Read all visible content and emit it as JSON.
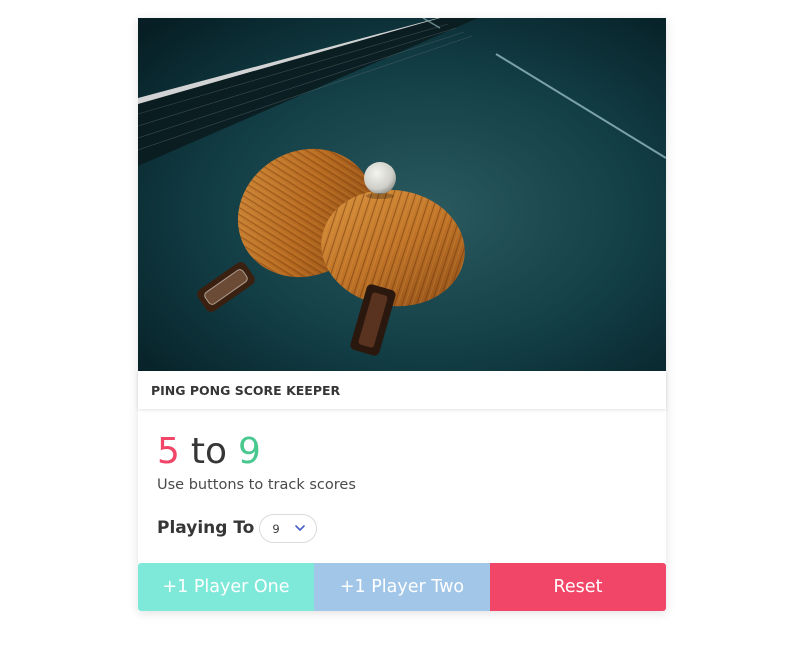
{
  "header": {
    "title": "PING PONG SCORE KEEPER"
  },
  "score": {
    "player_one": "5",
    "separator": "to",
    "player_two": "9"
  },
  "subtitle": "Use buttons to track scores",
  "playing_to": {
    "label": "Playing To",
    "selected_value": "9"
  },
  "buttons": {
    "player_one": "+1 Player One",
    "player_two": "+1 Player Two",
    "reset": "Reset"
  },
  "colors": {
    "player_one_score": "#f14668",
    "player_two_score": "#48c78e",
    "player_one_button": "#7ee8d9",
    "player_two_button": "#a2c6e8",
    "reset_button": "#f14668"
  },
  "icons": {
    "select_chevron": "chevron-down-icon"
  },
  "image": {
    "subject": "two wooden ping pong paddles and a ball on a table tennis table"
  }
}
